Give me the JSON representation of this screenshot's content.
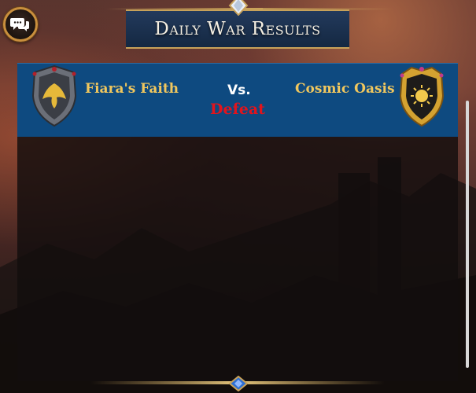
{
  "header": {
    "title": "Daily War Results"
  },
  "chat": {
    "icon": "chat-bubbles-icon"
  },
  "match": {
    "team_left": {
      "name": "Fiara's Faith",
      "crest": "winged-phoenix-crest-icon"
    },
    "vs_label": "Vs.",
    "outcome": "Defeat",
    "team_right": {
      "name": "Cosmic Oasis",
      "crest": "sun-crest-icon"
    }
  },
  "colors": {
    "header_band": "#0e4a80",
    "team_name": "#f0c75e",
    "defeat": "#e2141c",
    "gold_trim": "#c8a25a"
  }
}
